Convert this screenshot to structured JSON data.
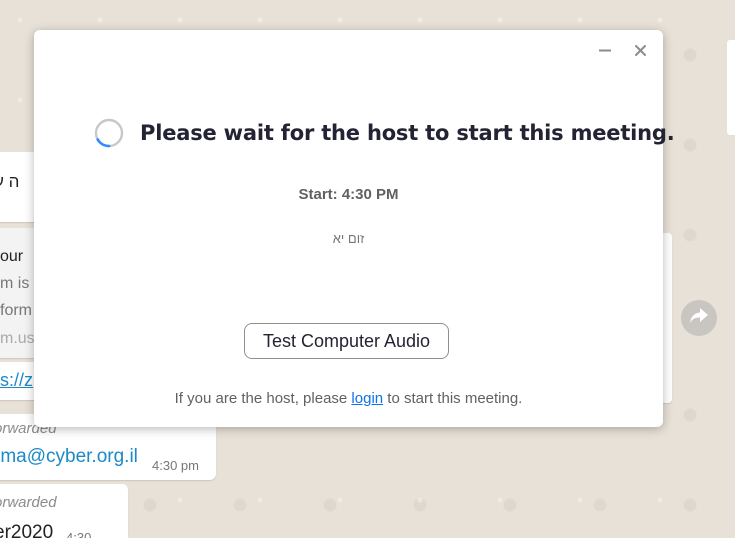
{
  "background_chat": {
    "hebrew_fragment": "ה ע",
    "preview_lines": [
      "our",
      "m is",
      "form",
      "m.us"
    ],
    "link_fragment": "s://z",
    "forwarded_label_1": "orwarded",
    "email_fragment": "rma@cyber.org.il",
    "time_1": "4:30 pm",
    "forwarded_label_2": "orwarded",
    "name_fragment": "er2020",
    "time_2": "4:30"
  },
  "dialog": {
    "title": "Please wait for the host to start this meeting.",
    "start_time": "Start: 4:30 PM",
    "meeting_topic": "זום יא",
    "test_audio_label": "Test Computer Audio",
    "host_note_prefix": "If you are the host, please ",
    "host_note_link": "login",
    "host_note_suffix": " to start this meeting."
  },
  "icons": {
    "minimize": "minimize-icon",
    "close": "close-icon",
    "spinner": "loading-spinner-icon",
    "share": "share-forward-icon"
  },
  "colors": {
    "accent": "#0e72ed",
    "headline": "#232333",
    "chat_link": "#1b8ac7"
  }
}
